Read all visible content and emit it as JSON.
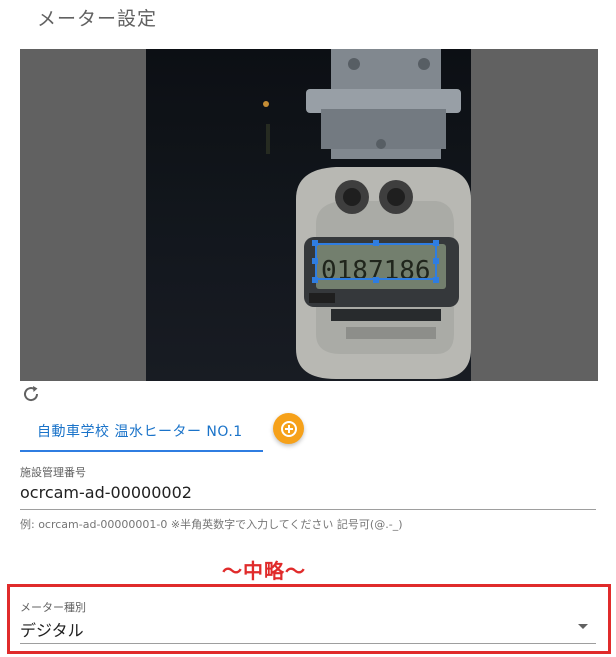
{
  "header": {
    "title": "メーター設定"
  },
  "camera": {
    "photo_alt": "メーター画像",
    "roi_color": "#2f7de1",
    "rotate_icon": "rotate-icon"
  },
  "tabs": [
    {
      "label": "自動車学校 温水ヒーター NO.1",
      "active": true
    }
  ],
  "add_button": {
    "icon": "plus-circle-icon",
    "color": "#f6a11a"
  },
  "facility_id": {
    "label": "施設管理番号",
    "value": "ocrcam-ad-00000002",
    "hint": "例: ocrcam-ad-00000001-0 ※半角英数字で入力してください 記号可(@.-_)"
  },
  "omitted_notice": "〜中略〜",
  "meter_type": {
    "label": "メーター種別",
    "value": "デジタル"
  },
  "colors": {
    "accent": "#2f7de1",
    "warning": "#e02b2b",
    "add": "#f6a11a"
  }
}
